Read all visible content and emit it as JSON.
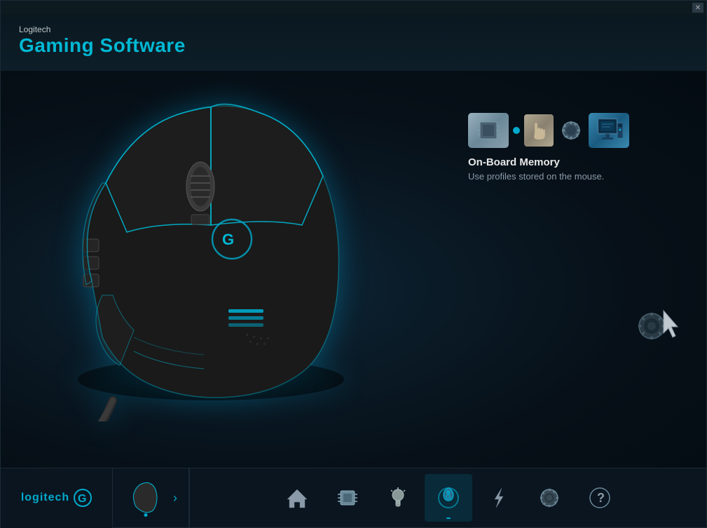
{
  "app": {
    "brand": "Logitech",
    "title": "Gaming Software",
    "close_button": "✕"
  },
  "onboard_memory": {
    "title": "On-Board Memory",
    "description": "Use profiles stored on the mouse."
  },
  "bottom_bar": {
    "logo_text": "logitech",
    "logo_symbol": "G",
    "nav_items": [
      {
        "id": "home",
        "label": "Home",
        "icon": "house"
      },
      {
        "id": "memory",
        "label": "Memory",
        "icon": "chip"
      },
      {
        "id": "lighting",
        "label": "Lighting",
        "icon": "bulb"
      },
      {
        "id": "onboard",
        "label": "On-Board",
        "icon": "mouse-g",
        "active": true
      },
      {
        "id": "assignments",
        "label": "Assignments",
        "icon": "lightning"
      },
      {
        "id": "settings",
        "label": "Settings",
        "icon": "gear"
      },
      {
        "id": "help",
        "label": "Help",
        "icon": "question"
      }
    ]
  }
}
